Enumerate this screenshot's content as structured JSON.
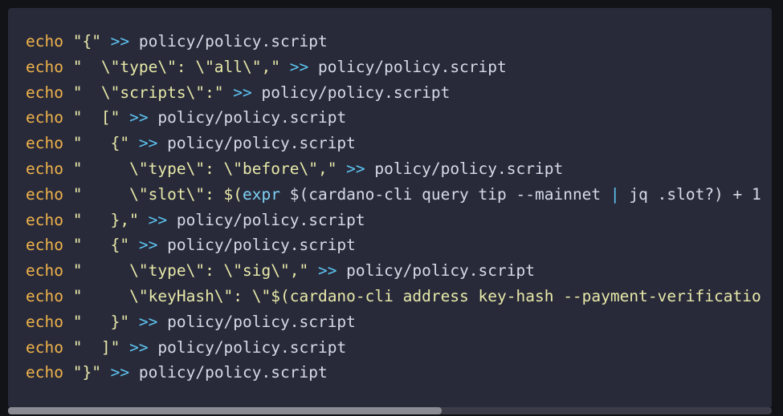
{
  "code": {
    "lines": [
      {
        "kw": "echo",
        "str": " \"{\" ",
        "op": ">>",
        "rest": " policy/policy.script"
      },
      {
        "kw": "echo",
        "str": " \"  \\\"type\\\": \\\"all\\\",\" ",
        "op": ">>",
        "rest": " policy/policy.script"
      },
      {
        "kw": "echo",
        "str": " \"  \\\"scripts\\\":\" ",
        "op": ">>",
        "rest": " policy/policy.script"
      },
      {
        "kw": "echo",
        "str": " \"  [\" ",
        "op": ">>",
        "rest": " policy/policy.script"
      },
      {
        "kw": "echo",
        "str": " \"   {\" ",
        "op": ">>",
        "rest": " policy/policy.script"
      },
      {
        "kw": "echo",
        "str": " \"     \\\"type\\\": \\\"before\\\",\" ",
        "op": ">>",
        "rest": " policy/policy.script"
      },
      {
        "kw": "echo",
        "str": " \"     \\\"slot\\\": $(",
        "op": "expr",
        "rest": " $(cardano-cli query tip --mainnet | jq .slot?) + 1"
      },
      {
        "kw": "echo",
        "str": " \"   },\" ",
        "op": ">>",
        "rest": " policy/policy.script"
      },
      {
        "kw": "echo",
        "str": " \"   {\" ",
        "op": ">>",
        "rest": " policy/policy.script"
      },
      {
        "kw": "echo",
        "str": " \"     \\\"type\\\": \\\"sig\\\",\" ",
        "op": ">>",
        "rest": " policy/policy.script"
      },
      {
        "kw": "echo",
        "str": " \"     \\\"keyHash\\\": \\\"$(cardano-cli address key-hash --payment-verificatio",
        "op": "",
        "rest": ""
      },
      {
        "kw": "echo",
        "str": " \"   }\" ",
        "op": ">>",
        "rest": " policy/policy.script"
      },
      {
        "kw": "echo",
        "str": " \"  ]\" ",
        "op": ">>",
        "rest": " policy/policy.script"
      },
      {
        "kw": "echo",
        "str": " \"}\" ",
        "op": ">>",
        "rest": " policy/policy.script"
      }
    ]
  },
  "scrollbar": {
    "horizontal_position_fraction": 0.0
  }
}
